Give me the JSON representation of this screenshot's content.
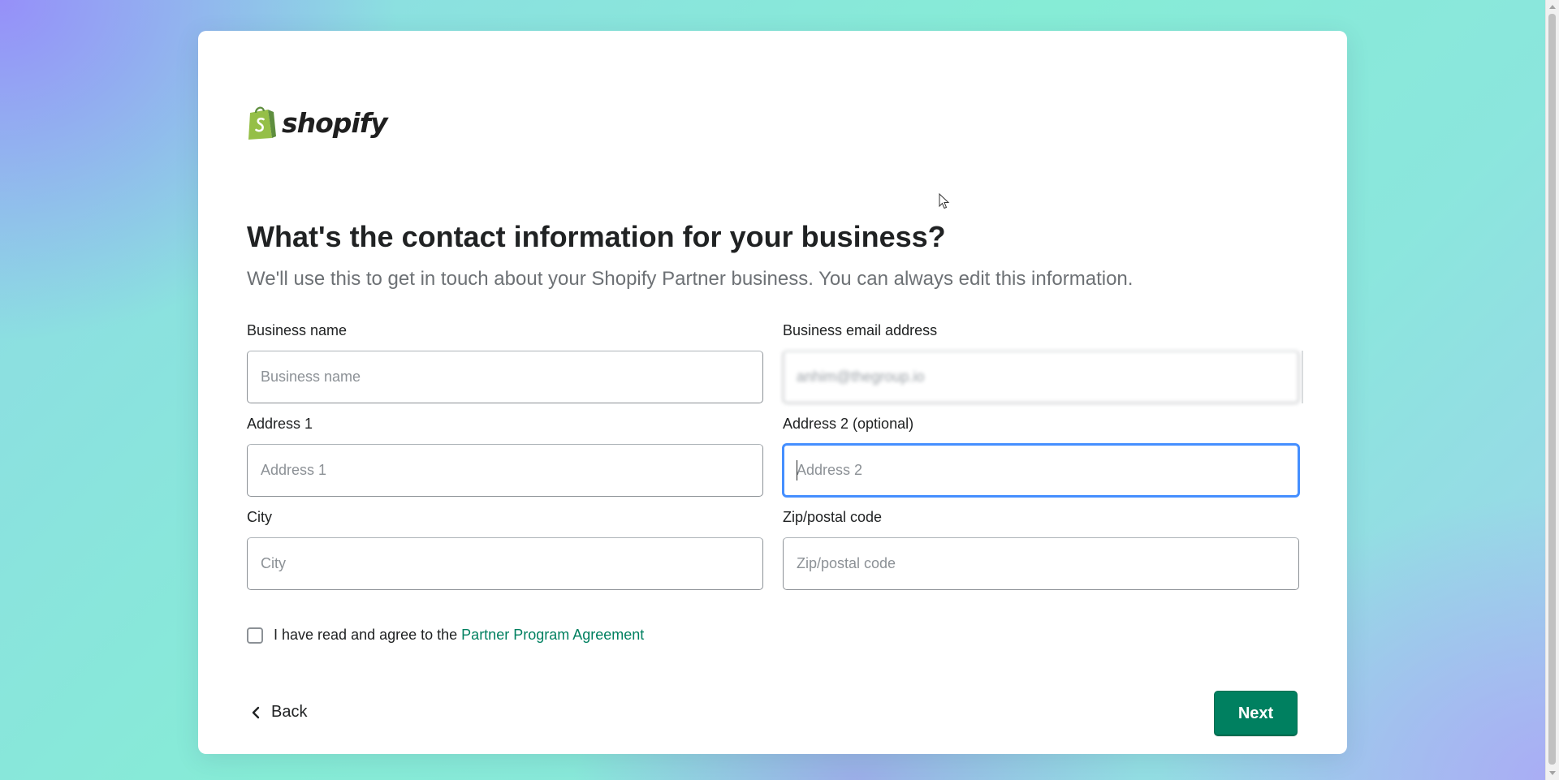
{
  "brand": {
    "name": "shopify",
    "bag_color": "#95bf47",
    "bag_dark_color": "#5e8e3e"
  },
  "header": {
    "title": "What's the contact information for your business?",
    "subtitle": "We'll use this to get in touch about your Shopify Partner business. You can always edit this information."
  },
  "form": {
    "business_name": {
      "label": "Business name",
      "placeholder": "Business name",
      "value": ""
    },
    "business_email": {
      "label": "Business email address",
      "placeholder": "",
      "value": "anhim@thegroup.io"
    },
    "address1": {
      "label": "Address 1",
      "placeholder": "Address 1",
      "value": ""
    },
    "address2": {
      "label": "Address 2 (optional)",
      "placeholder": "Address 2",
      "value": "",
      "focused": true
    },
    "city": {
      "label": "City",
      "placeholder": "City",
      "value": ""
    },
    "zip": {
      "label": "Zip/postal code",
      "placeholder": "Zip/postal code",
      "value": ""
    }
  },
  "agreement": {
    "text": "I have read and agree to the",
    "link_text": "Partner Program Agreement",
    "checked": false
  },
  "actions": {
    "back_label": "Back",
    "next_label": "Next"
  },
  "colors": {
    "primary": "#008060",
    "focus_ring": "#458fff",
    "link": "#008060"
  }
}
